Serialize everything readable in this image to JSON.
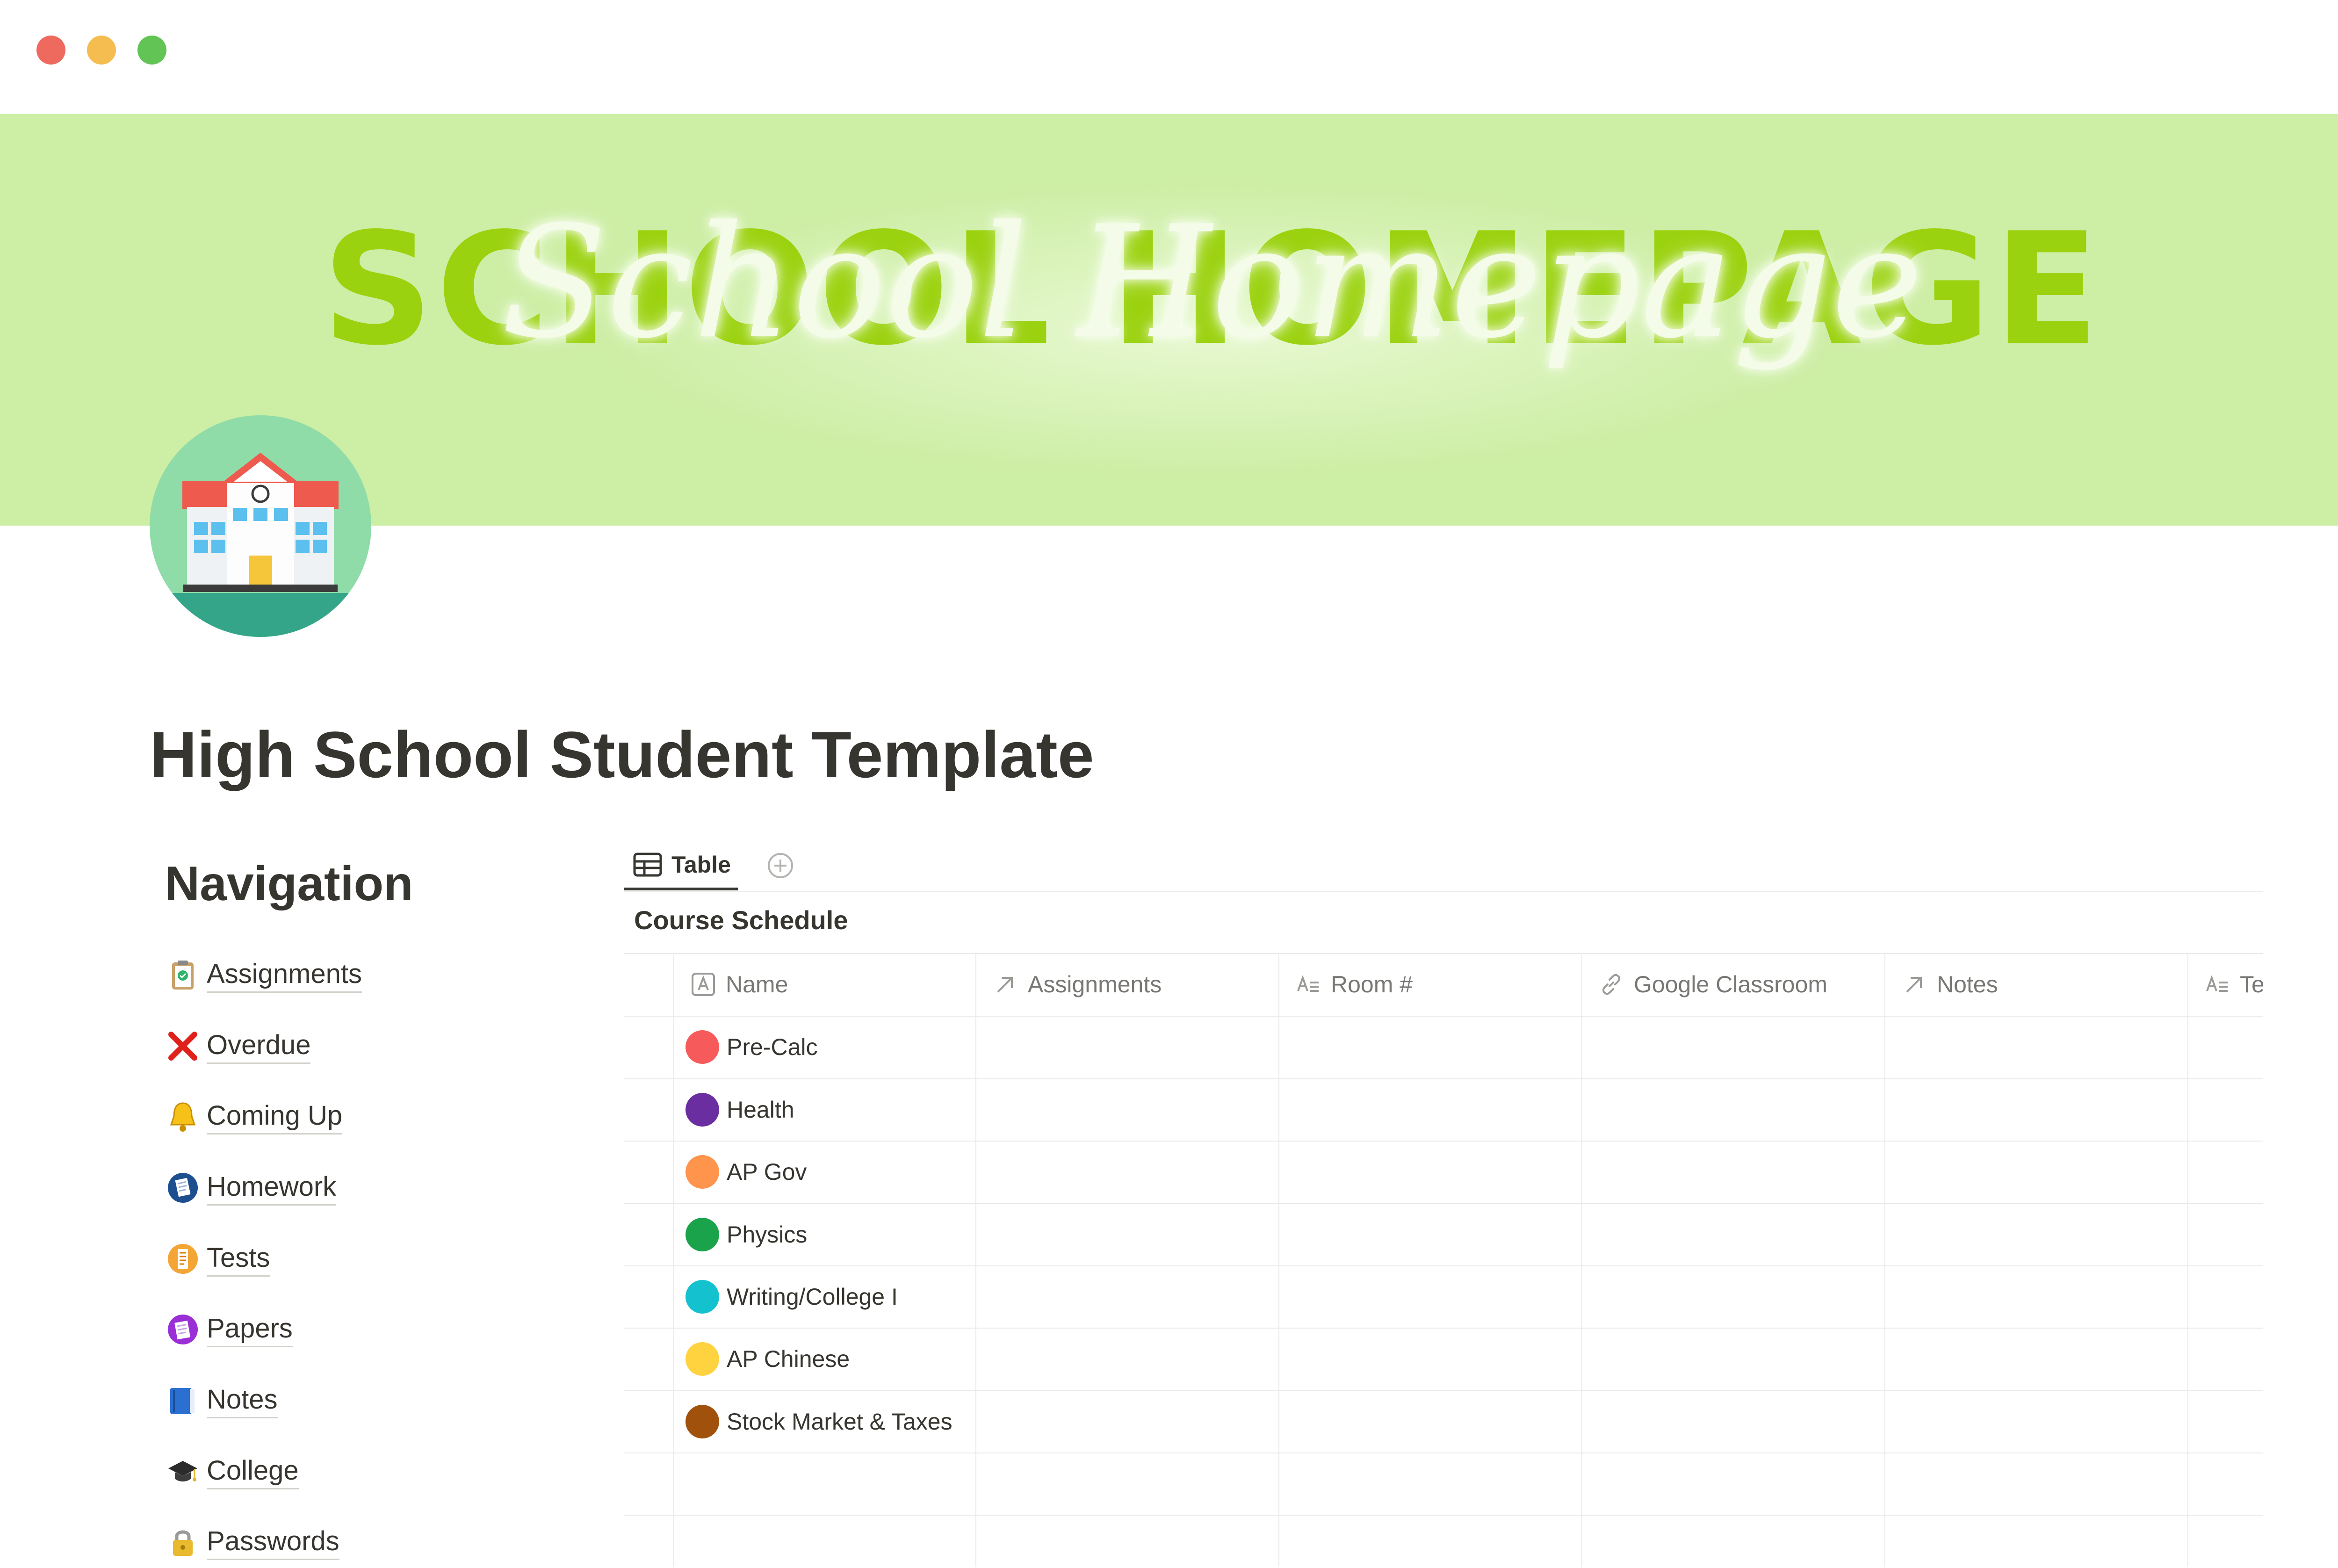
{
  "cover": {
    "block_text": "SCHOOL HOMEPAGE",
    "script_text": "School Homepage",
    "background": "#cdeea5",
    "accent": "#9bd20f"
  },
  "page": {
    "icon": "school-building-icon",
    "title": "High School Student Template"
  },
  "navigation": {
    "heading": "Navigation",
    "items": [
      {
        "label": "Assignments",
        "icon": "clipboard-check-icon"
      },
      {
        "label": "Overdue",
        "icon": "cross-mark-icon"
      },
      {
        "label": "Coming Up",
        "icon": "bell-icon"
      },
      {
        "label": "Homework",
        "icon": "homework-icon"
      },
      {
        "label": "Tests",
        "icon": "test-paper-icon"
      },
      {
        "label": "Papers",
        "icon": "papers-icon"
      },
      {
        "label": "Notes",
        "icon": "blue-book-icon"
      },
      {
        "label": "College",
        "icon": "graduation-cap-icon"
      },
      {
        "label": "Passwords",
        "icon": "lock-icon"
      }
    ]
  },
  "database": {
    "view_tab": "Table",
    "title": "Course Schedule",
    "columns": [
      {
        "label": "Name",
        "icon": "title-property-icon"
      },
      {
        "label": "Assignments",
        "icon": "relation-arrow-icon"
      },
      {
        "label": "Room #",
        "icon": "text-property-icon"
      },
      {
        "label": "Google Classroom",
        "icon": "link-icon"
      },
      {
        "label": "Notes",
        "icon": "relation-arrow-icon"
      },
      {
        "label": "Te",
        "icon": "text-property-icon"
      }
    ],
    "rows": [
      {
        "name": "Pre-Calc",
        "color": "#f75a5a"
      },
      {
        "name": "Health",
        "color": "#6a2ea0"
      },
      {
        "name": "AP Gov",
        "color": "#ff944d"
      },
      {
        "name": "Physics",
        "color": "#1aa34a"
      },
      {
        "name": "Writing/College I",
        "color": "#14c2cf"
      },
      {
        "name": "AP Chinese",
        "color": "#ffd23f"
      },
      {
        "name": "Stock Market & Taxes",
        "color": "#a0520c"
      }
    ]
  }
}
